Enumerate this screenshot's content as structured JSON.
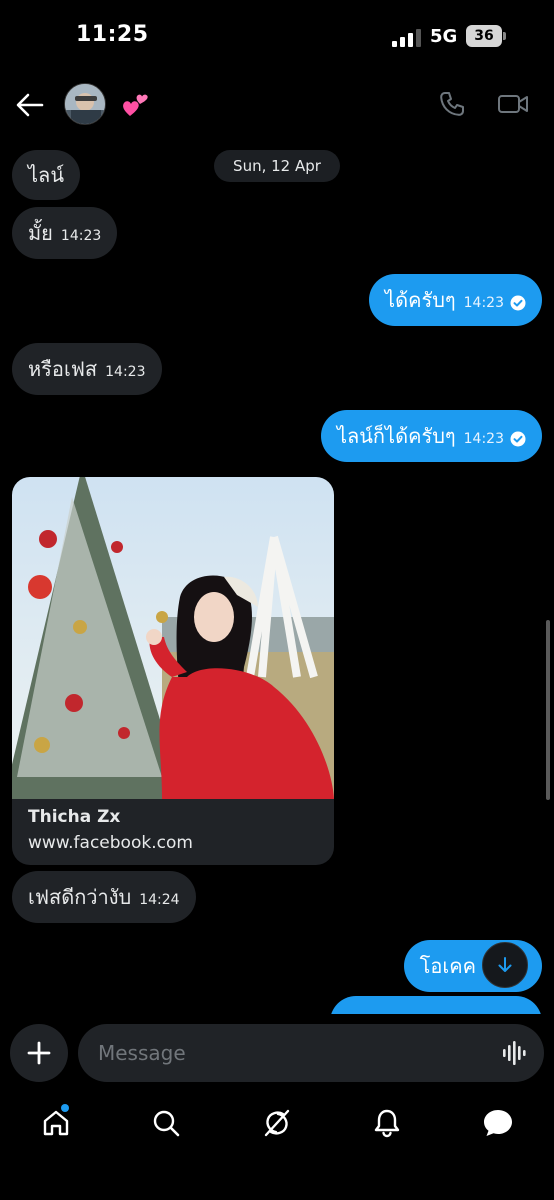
{
  "status_bar": {
    "time": "11:25",
    "network": "5G",
    "battery": "36"
  },
  "header": {
    "hearts_emoji": "💕",
    "icons": [
      "back-arrow-icon",
      "phone-icon",
      "video-camera-icon"
    ]
  },
  "chat": {
    "date_chip": "Sun, 12 Apr",
    "messages": [
      {
        "dir": "in",
        "text": "ไลน์",
        "time": ""
      },
      {
        "dir": "in",
        "text": "มั้ย",
        "time": "14:23"
      },
      {
        "dir": "out",
        "text": "ได้ครับๆ",
        "time": "14:23"
      },
      {
        "dir": "in",
        "text": "หรือเฟส",
        "time": "14:23"
      },
      {
        "dir": "out",
        "text": "ไลน์ก็ได้ครับๆ",
        "time": "14:23"
      },
      {
        "dir": "in",
        "text": "เฟสดีกว่างับ",
        "time": "14:24"
      },
      {
        "dir": "out",
        "text": "โอเคค",
        "time": ""
      }
    ],
    "link_card": {
      "title": "Thicha Zx",
      "domain": "www.facebook.com"
    }
  },
  "composer": {
    "placeholder": "Message"
  },
  "colors": {
    "accent": "#1d9bf0",
    "incoming_bubble": "#202327",
    "background": "#000000"
  },
  "bottom_nav": {
    "items": [
      "home-icon",
      "search-icon",
      "grok-icon",
      "bell-icon",
      "messages-icon"
    ]
  }
}
